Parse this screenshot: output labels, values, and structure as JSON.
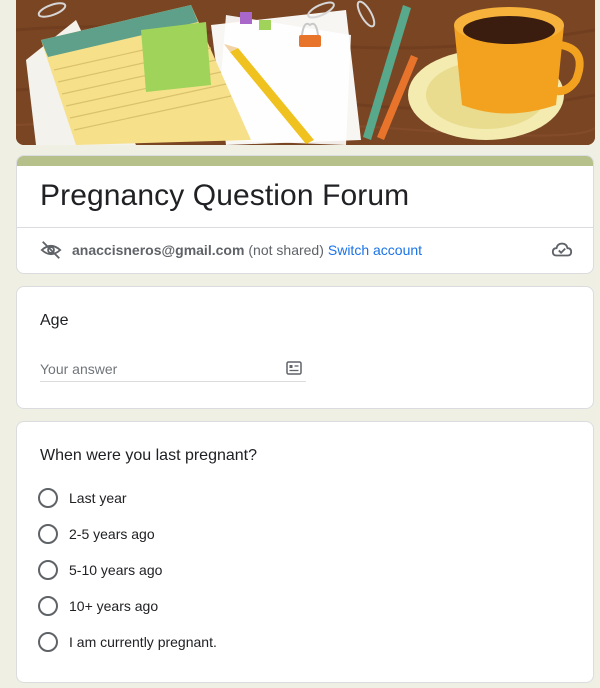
{
  "form": {
    "title": "Pregnancy Question Forum",
    "accent_color": "#b6c08a",
    "account": {
      "email": "anaccisneros@gmail.com",
      "not_shared": "(not shared)",
      "switch_label": "Switch account",
      "icons": [
        "eye-off-icon",
        "cloud-check-icon"
      ]
    }
  },
  "questions": {
    "age": {
      "label": "Age",
      "placeholder": "Your answer",
      "value": "",
      "icon": "contact-card-icon"
    },
    "last_pregnant": {
      "label": "When were you last pregnant?",
      "options": [
        "Last year",
        "2-5 years ago",
        "5-10 years ago",
        "10+ years ago",
        "I am currently pregnant."
      ]
    }
  },
  "colors": {
    "background": "#f0efe3",
    "link": "#1a73e8",
    "banner_wood": "#7a4523"
  }
}
